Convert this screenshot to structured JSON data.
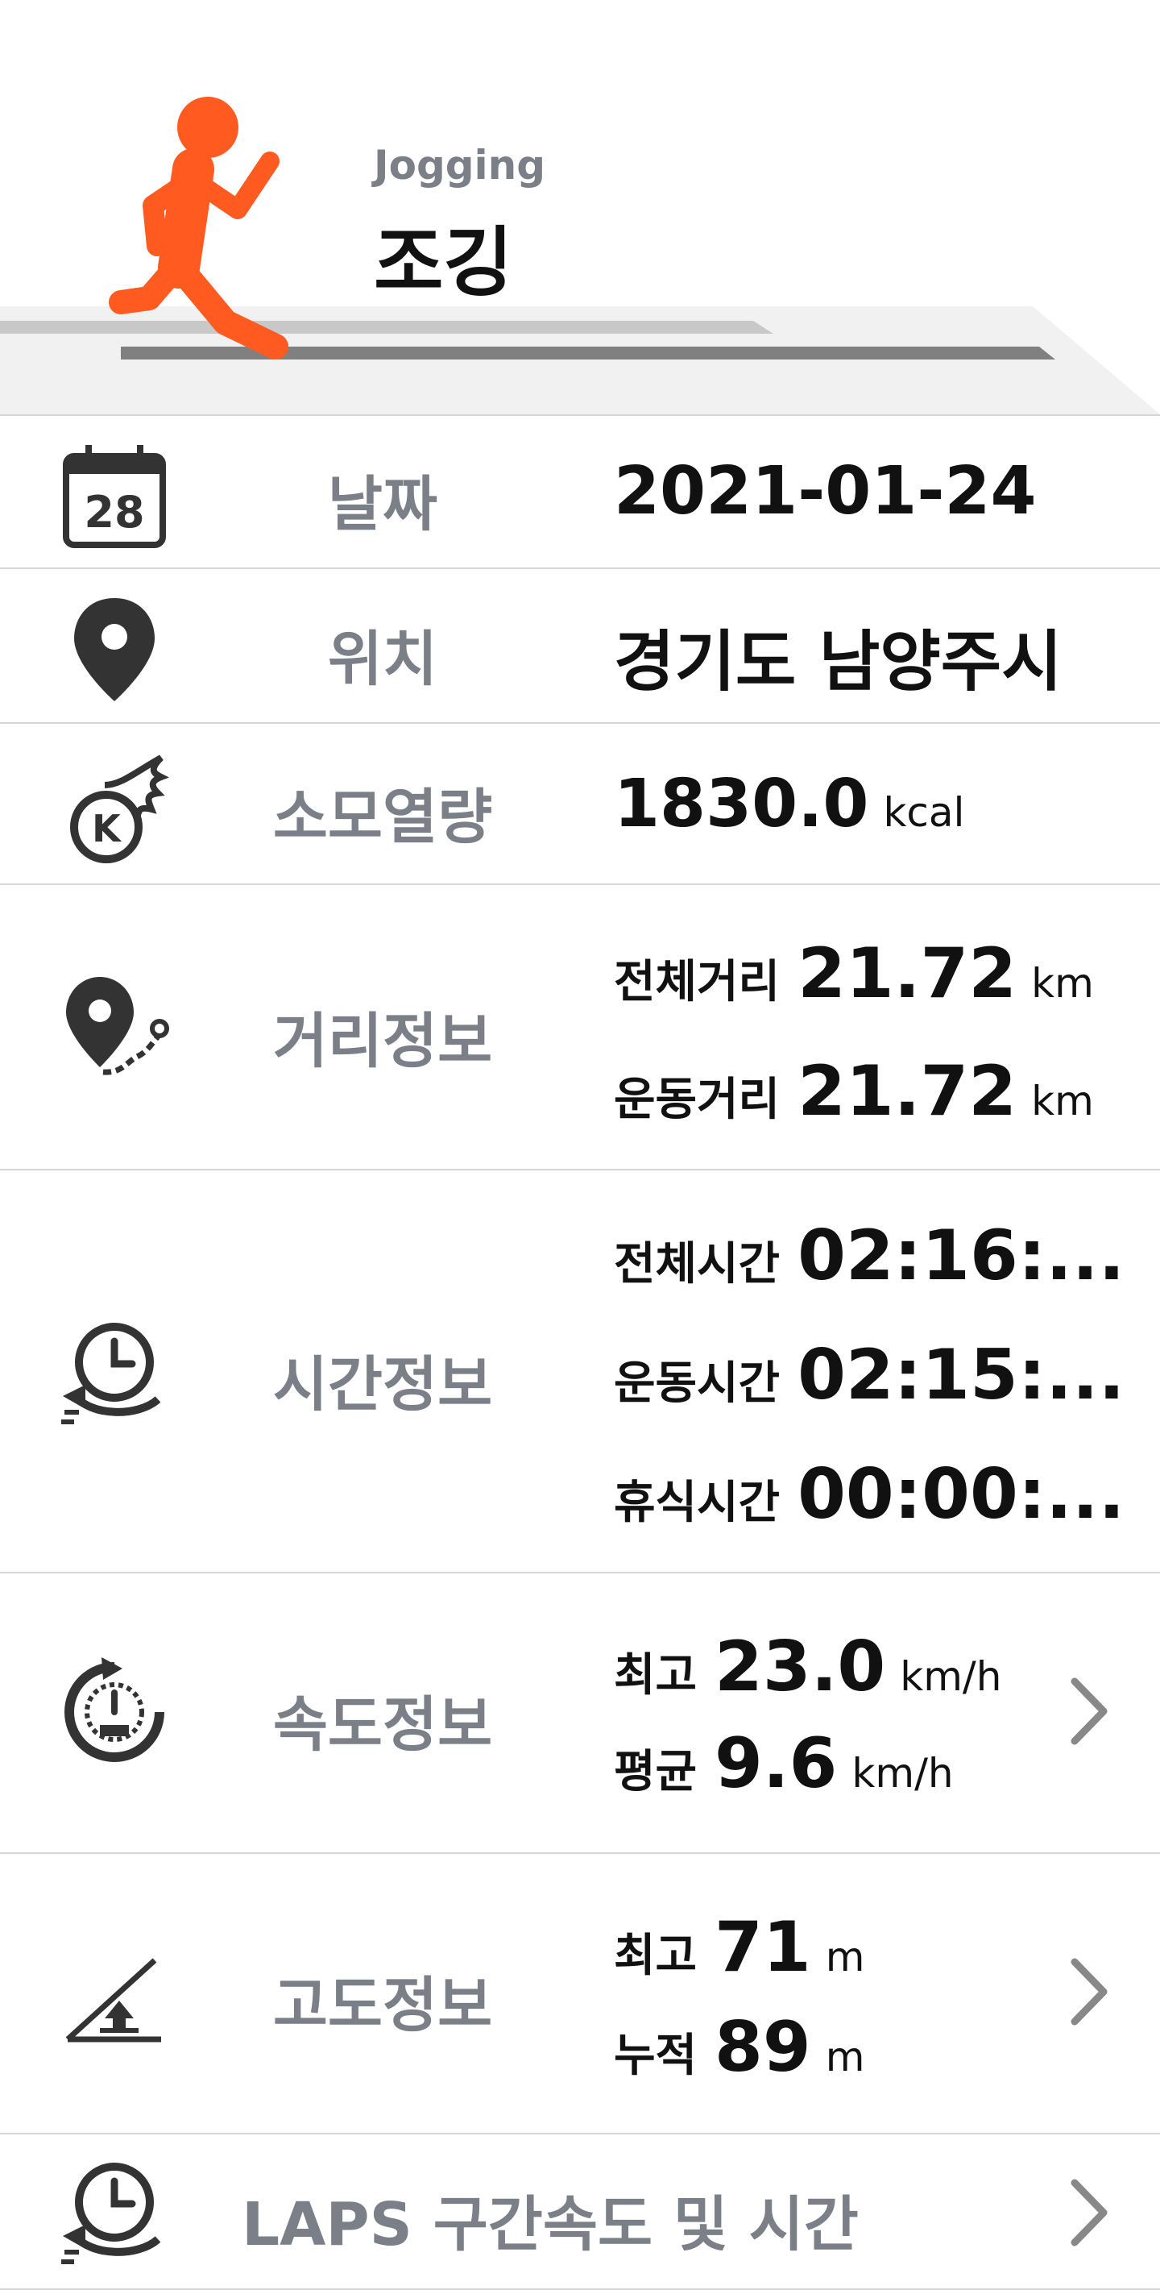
{
  "header": {
    "subtitle": "Jogging",
    "title": "조깅",
    "runner_color": "#FF5A1F"
  },
  "rows": {
    "date": {
      "icon": "calendar-icon",
      "calendar_day": "28",
      "label": "날짜",
      "value": "2021-01-24"
    },
    "location": {
      "icon": "map-pin-icon",
      "label": "위치",
      "value": "경기도 남양주시"
    },
    "calories": {
      "icon": "calorie-fire-icon",
      "icon_letter": "K",
      "label": "소모열량",
      "value": "1830.0",
      "unit": "kcal"
    },
    "distance": {
      "icon": "route-pin-icon",
      "label": "거리정보",
      "total_label": "전체거리",
      "total_value": "21.72",
      "total_unit": "km",
      "moving_label": "운동거리",
      "moving_value": "21.72",
      "moving_unit": "km"
    },
    "time": {
      "icon": "clock-loop-icon",
      "label": "시간정보",
      "total_label": "전체시간",
      "total_value": "02:16:...",
      "moving_label": "운동시간",
      "moving_value": "02:15:...",
      "rest_label": "휴식시간",
      "rest_value": "00:00:..."
    },
    "speed": {
      "icon": "speedometer-icon",
      "label": "속도정보",
      "max_label": "최고",
      "max_value": "23.0",
      "max_unit": "km/h",
      "avg_label": "평균",
      "avg_value": "9.6",
      "avg_unit": "km/h"
    },
    "altitude": {
      "icon": "elevation-icon",
      "label": "고도정보",
      "max_label": "최고",
      "max_value": "71",
      "max_unit": "m",
      "cum_label": "누적",
      "cum_value": "89",
      "cum_unit": "m"
    },
    "laps": {
      "icon": "laps-clock-icon",
      "label": "LAPS 구간속도 및 시간"
    }
  },
  "colors": {
    "label_gray": "#7B7F87",
    "icon_dark": "#333333",
    "divider": "#D6D6D6",
    "chevron": "#888888"
  }
}
